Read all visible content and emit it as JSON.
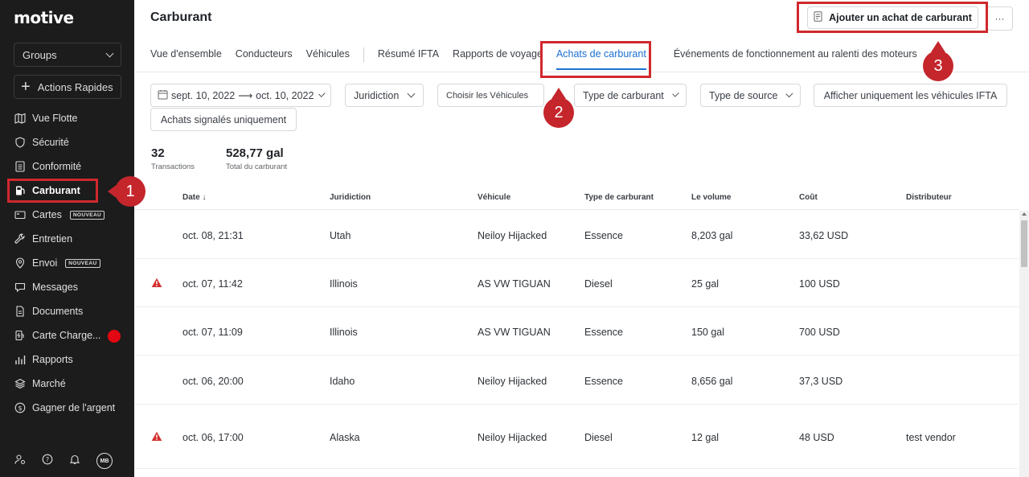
{
  "sidebar": {
    "logo": "motive",
    "groups_label": "Groups",
    "quick_actions_label": "Actions Rapides",
    "items": [
      {
        "label": "Vue Flotte",
        "icon": "map-icon"
      },
      {
        "label": "Sécurité",
        "icon": "shield-icon"
      },
      {
        "label": "Conformité",
        "icon": "document-list-icon"
      },
      {
        "label": "Carburant",
        "icon": "fuel-pump-icon",
        "active": true
      },
      {
        "label": "Cartes",
        "icon": "card-icon",
        "badge": "NOUVEAU"
      },
      {
        "label": "Entretien",
        "icon": "wrench-icon"
      },
      {
        "label": "Envoi",
        "icon": "location-pin-icon",
        "badge": "NOUVEAU"
      },
      {
        "label": "Messages",
        "icon": "chat-icon"
      },
      {
        "label": "Documents",
        "icon": "file-icon"
      },
      {
        "label": "Carte Charge...",
        "icon": "ev-charger-icon"
      },
      {
        "label": "Rapports",
        "icon": "bar-chart-icon"
      },
      {
        "label": "Marché",
        "icon": "layers-icon"
      },
      {
        "label": "Gagner de l'argent",
        "icon": "dollar-circle-icon"
      }
    ],
    "avatar_initials": "MB"
  },
  "header": {
    "title": "Carburant",
    "add_button_label": "Ajouter un achat de carburant",
    "more_label": "···"
  },
  "tabs": [
    {
      "label": "Vue d'ensemble"
    },
    {
      "label": "Conducteurs"
    },
    {
      "label": "Véhicules"
    },
    {
      "label": "Résumé IFTA"
    },
    {
      "label": "Rapports de voyage"
    },
    {
      "label": "Achats de carburant",
      "active": true
    },
    {
      "label": "Événements de fonctionnement au ralenti des moteurs"
    }
  ],
  "filters": {
    "date_start": "sept. 10, 2022",
    "date_end": "oct. 10, 2022",
    "jurisdiction": "Juridiction",
    "vehicles": "Choisir les Véhicules",
    "fuel_type": "Type de carburant",
    "source_type": "Type de source",
    "ifta_only": "Afficher uniquement les véhicules IFTA",
    "flagged_only": "Achats signalés uniquement"
  },
  "stats": {
    "transactions_value": "32",
    "transactions_label": "Transactions",
    "total_value": "528,77 gal",
    "total_label": "Total du carburant"
  },
  "table": {
    "columns": [
      "Date",
      "Juridiction",
      "Véhicule",
      "Type de carburant",
      "Le volume",
      "Coût",
      "Distributeur"
    ],
    "sort_arrow": "↓",
    "rows": [
      {
        "flag": false,
        "date": "oct. 08, 21:31",
        "jurisdiction": "Utah",
        "vehicle": "Neiloy Hijacked",
        "fuel": "Essence",
        "volume": "8,203 gal",
        "cost": "33,62 USD",
        "vendor": ""
      },
      {
        "flag": true,
        "date": "oct. 07, 11:42",
        "jurisdiction": "Illinois",
        "vehicle": "AS VW TIGUAN",
        "fuel": "Diesel",
        "volume": "25 gal",
        "cost": "100 USD",
        "vendor": ""
      },
      {
        "flag": false,
        "date": "oct. 07, 11:09",
        "jurisdiction": "Illinois",
        "vehicle": "AS VW TIGUAN",
        "fuel": "Essence",
        "volume": "150 gal",
        "cost": "700 USD",
        "vendor": ""
      },
      {
        "flag": false,
        "date": "oct. 06, 20:00",
        "jurisdiction": "Idaho",
        "vehicle": "Neiloy Hijacked",
        "fuel": "Essence",
        "volume": "8,656 gal",
        "cost": "37,3 USD",
        "vendor": ""
      },
      {
        "flag": true,
        "date": "oct. 06, 17:00",
        "jurisdiction": "Alaska",
        "vehicle": "Neiloy Hijacked",
        "fuel": "Diesel",
        "volume": "12 gal",
        "cost": "48 USD",
        "vendor": "test vendor"
      }
    ]
  },
  "annotations": [
    "1",
    "2",
    "3"
  ],
  "colors": {
    "accent": "#1a6fd1",
    "annotation": "#c4262c",
    "sidebar_bg": "#1c1c1c",
    "warning": "#d32f2f"
  }
}
